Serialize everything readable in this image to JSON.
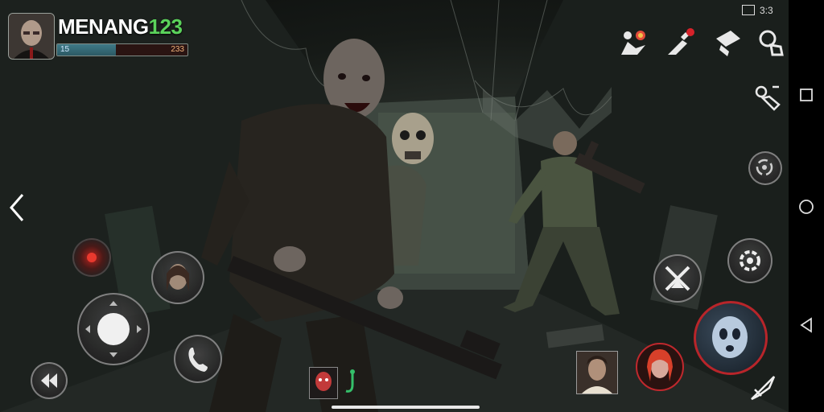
{
  "player": {
    "name": "MENANG",
    "name_number": "123",
    "bar_left_text": "15",
    "bar_right_text": "233",
    "bar_fill_fraction": 0.45
  },
  "status_bar": {
    "text": "3:3"
  },
  "top_actions": [
    {
      "icon": "character-bouquet-icon"
    },
    {
      "icon": "hand-gift-icon"
    },
    {
      "icon": "supply-crate-icon"
    },
    {
      "icon": "search-profile-icon"
    }
  ],
  "colors": {
    "name_accent": "#5bd25b",
    "bar_fill": "#3f7a87",
    "skill_ring": "#c0282d",
    "ghost_ring": "#b8252a"
  },
  "nav": {
    "square": "recent-apps",
    "circle": "home",
    "triangle": "back"
  }
}
